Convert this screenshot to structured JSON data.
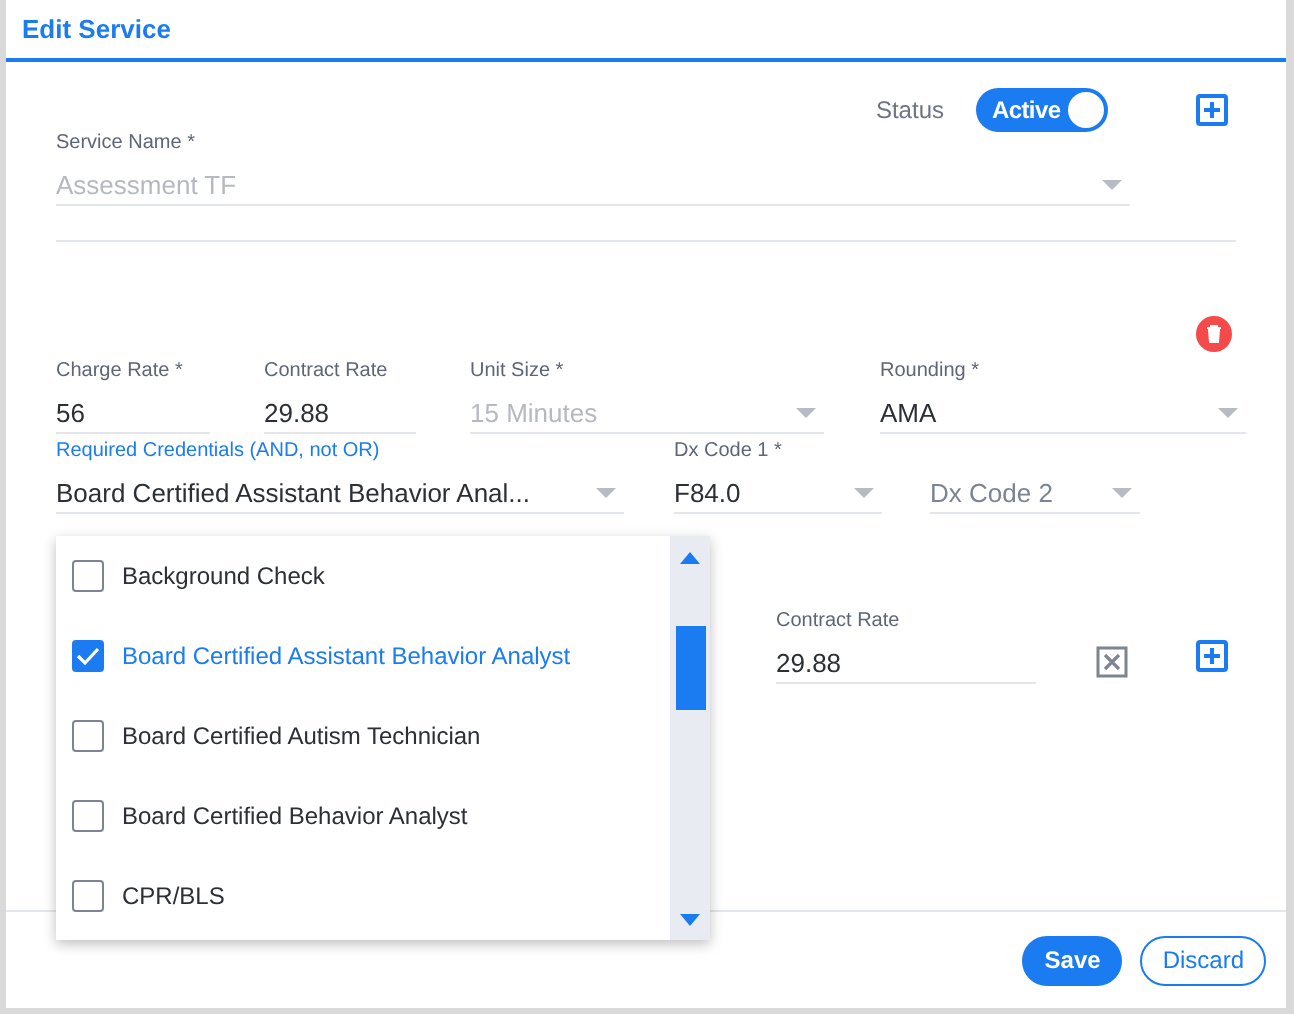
{
  "dialog": {
    "title": "Edit Service"
  },
  "status": {
    "label": "Status",
    "toggle": {
      "label": "Active",
      "on": true
    }
  },
  "service_name": {
    "label": "Service Name *",
    "value": "Assessment TF",
    "disabled": true
  },
  "rates": [
    {
      "label": "Charge Rate *",
      "value": "56",
      "kind": "text",
      "disabled": false
    },
    {
      "label": "Contract Rate",
      "value": "29.88",
      "kind": "text",
      "disabled": false
    },
    {
      "label": "Unit Size *",
      "value": "15 Minutes",
      "kind": "select",
      "disabled": true
    },
    {
      "label": "Rounding *",
      "value": "AMA",
      "kind": "select",
      "disabled": false
    }
  ],
  "credentials": {
    "label": "Required Credentials (AND, not OR)",
    "value": "Board Certified Assistant Behavior Anal...",
    "focused": true
  },
  "dx_codes": [
    {
      "label": "Dx Code 1 *",
      "value": "F84.0"
    },
    {
      "placeholder": "Dx Code 2"
    }
  ],
  "credential_options": [
    {
      "label": "Background Check",
      "checked": false
    },
    {
      "label": "Board Certified Assistant Behavior Analyst",
      "checked": true
    },
    {
      "label": "Board Certified Autism Technician",
      "checked": false
    },
    {
      "label": "Board Certified Behavior Analyst",
      "checked": false
    },
    {
      "label": "CPR/BLS",
      "checked": false
    }
  ],
  "second_rate": {
    "label": "Contract Rate",
    "value": "29.88"
  },
  "buttons": [
    {
      "label": "Save",
      "kind": "primary"
    },
    {
      "label": "Discard",
      "kind": "outline"
    }
  ]
}
